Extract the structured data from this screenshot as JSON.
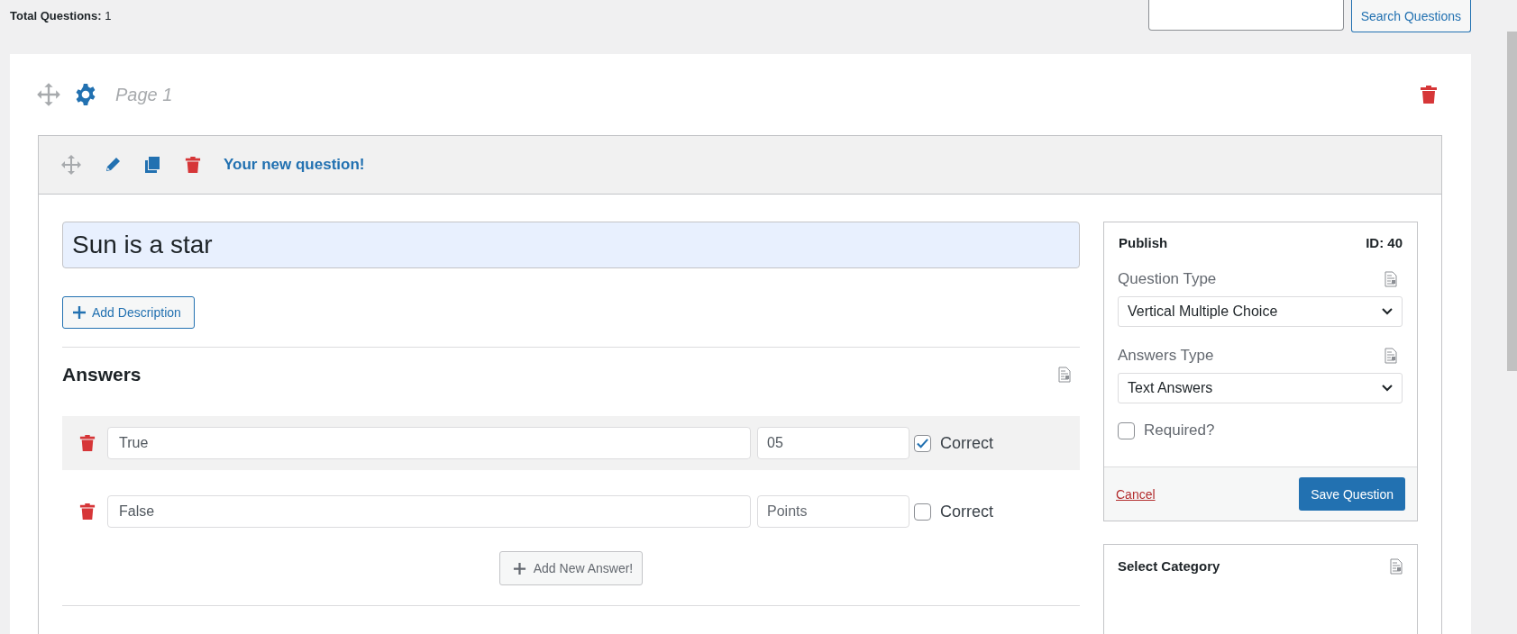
{
  "header": {
    "total_questions": "**Total Questions:** 1"
  },
  "search": {
    "button": "Search Questions"
  },
  "page": {
    "title": "Page 1"
  },
  "question": {
    "header_title": "Your new question!",
    "title_value": "Sun is a star",
    "add_description": "Add Description",
    "answers_heading": "Answers",
    "answers": [
      {
        "value": "True",
        "points": "05",
        "correct": true,
        "highlighted": true,
        "correct_label": "Correct"
      },
      {
        "value": "False",
        "points_placeholder": "Points",
        "correct": false,
        "highlighted": false,
        "correct_label": "Correct"
      }
    ],
    "add_answer": "Add New Answer!"
  },
  "publish": {
    "title": "Publish",
    "id": "ID: 40",
    "fields": [
      {
        "label": "Question Type",
        "value": "Vertical Multiple Choice"
      },
      {
        "label": "Answers Type",
        "value": "Text Answers"
      }
    ],
    "required": {
      "label": "Required?",
      "checked": false
    },
    "cancel": "Cancel",
    "save": "Save Question"
  },
  "category": {
    "title": "Select Category"
  }
}
